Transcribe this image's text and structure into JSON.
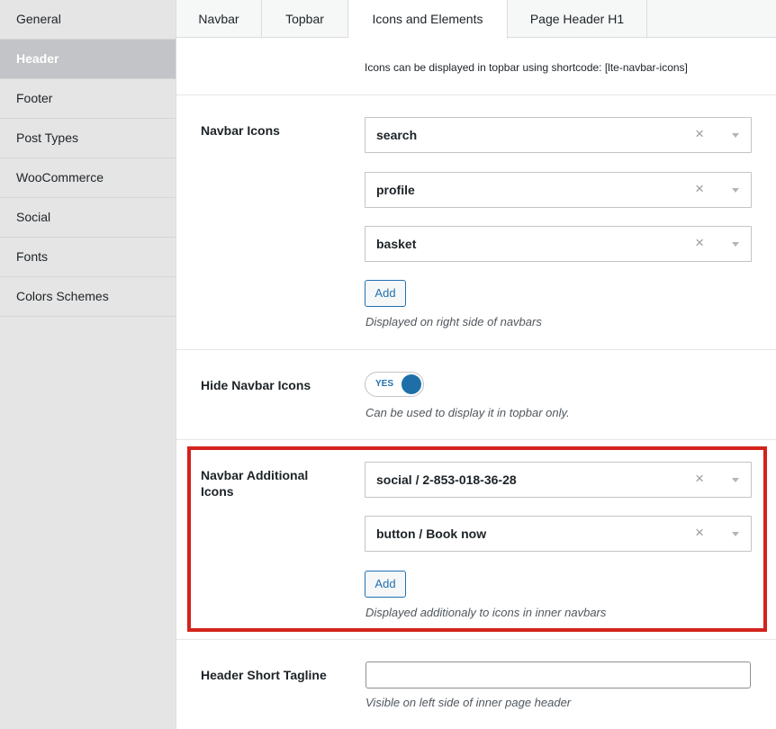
{
  "sidebar": {
    "items": [
      {
        "label": "General"
      },
      {
        "label": "Header"
      },
      {
        "label": "Footer"
      },
      {
        "label": "Post Types"
      },
      {
        "label": "WooCommerce"
      },
      {
        "label": "Social"
      },
      {
        "label": "Fonts"
      },
      {
        "label": "Colors Schemes"
      }
    ],
    "active_index": 1
  },
  "tabs": [
    {
      "label": "Navbar"
    },
    {
      "label": "Topbar"
    },
    {
      "label": "Icons and Elements"
    },
    {
      "label": "Page Header H1"
    }
  ],
  "notice": "Icons can be displayed in topbar using shortcode: [lte-navbar-icons]",
  "navbar_icons": {
    "label": "Navbar Icons",
    "items": [
      {
        "value": "search"
      },
      {
        "value": "profile"
      },
      {
        "value": "basket"
      }
    ],
    "add_label": "Add",
    "help": "Displayed on right side of navbars"
  },
  "hide_navbar_icons": {
    "label": "Hide Navbar Icons",
    "toggle_label": "YES",
    "enabled": true,
    "help": "Can be used to display it in topbar only."
  },
  "navbar_additional_icons": {
    "label": "Navbar Additional Icons",
    "items": [
      {
        "value": "social / 2-853-018-36-28"
      },
      {
        "value": "button / Book now"
      }
    ],
    "add_label": "Add",
    "help": "Displayed additionaly to icons in inner navbars"
  },
  "header_short_tagline": {
    "label": "Header Short Tagline",
    "value": "",
    "help": "Visible on left side of inner page header"
  },
  "select_clear_glyph": "×",
  "colors": {
    "accent": "#2271b1",
    "highlight_border": "#d3231c",
    "active_sidebar_bg": "#c3c4c7"
  }
}
